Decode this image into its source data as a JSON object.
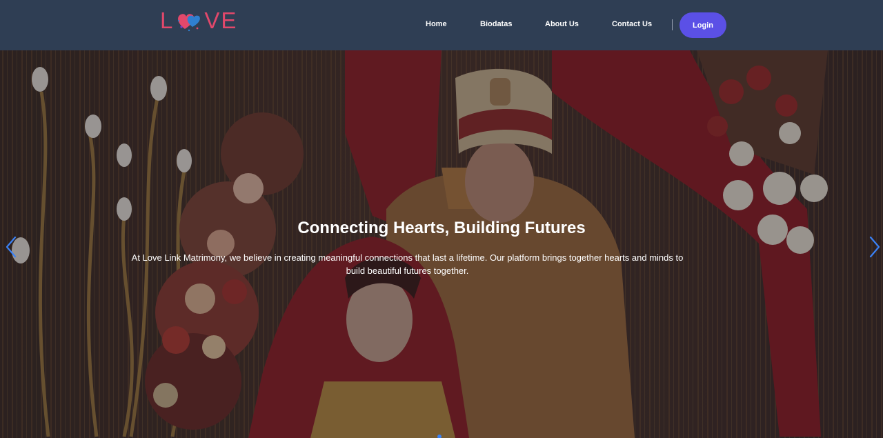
{
  "brand": {
    "logo_left": "L",
    "logo_right": "VE",
    "logo_color": "#e2486b"
  },
  "nav": {
    "items": [
      {
        "label": "Home"
      },
      {
        "label": "Biodatas"
      },
      {
        "label": "About Us"
      },
      {
        "label": "Contact Us"
      }
    ],
    "login_label": "Login",
    "background": "#2f3e54",
    "login_color": "#5b50e6"
  },
  "hero": {
    "title": "Connecting Hearts, Building Futures",
    "description": "At Love Link Matrimony, we believe in creating meaningful connections that last a lifetime. Our platform brings together hearts and minds to build beautiful futures together.",
    "prev_icon": "chevron-left-icon",
    "next_icon": "chevron-right-icon",
    "arrow_color": "#3b82f6"
  }
}
